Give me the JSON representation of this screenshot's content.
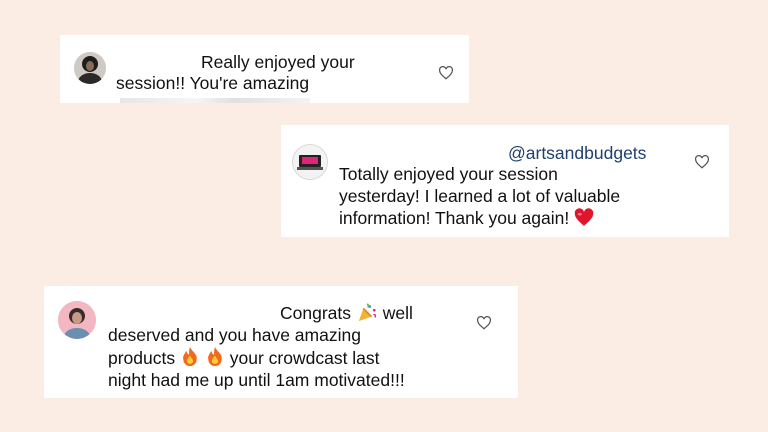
{
  "colors": {
    "background": "#fbece4",
    "card": "#ffffff",
    "handle": "#1f3f6e",
    "heart_outline": "#555555"
  },
  "comments": [
    {
      "avatar_icon": "user-avatar-icon",
      "lines": [
        "Really enjoyed your",
        "session!! You're amazing"
      ],
      "like_icon": "heart-outline-icon"
    },
    {
      "avatar_icon": "brand-avatar-icon",
      "handle": "@artsandbudgets",
      "lines": [
        "Totally enjoyed your session",
        "yesterday!  I learned a lot of valuable",
        "information! Thank you again!"
      ],
      "emoji_end": "red-heart-emoji",
      "like_icon": "heart-outline-icon"
    },
    {
      "avatar_icon": "user-avatar-icon",
      "lines": [
        "Congrats",
        "well",
        "deserved and you have amazing",
        "products",
        "your crowdcast last",
        "night had me up until 1am motivated!!!"
      ],
      "emojis": [
        "party-popper-emoji",
        "fire-emoji",
        "fire-emoji"
      ],
      "like_icon": "heart-outline-icon"
    }
  ]
}
